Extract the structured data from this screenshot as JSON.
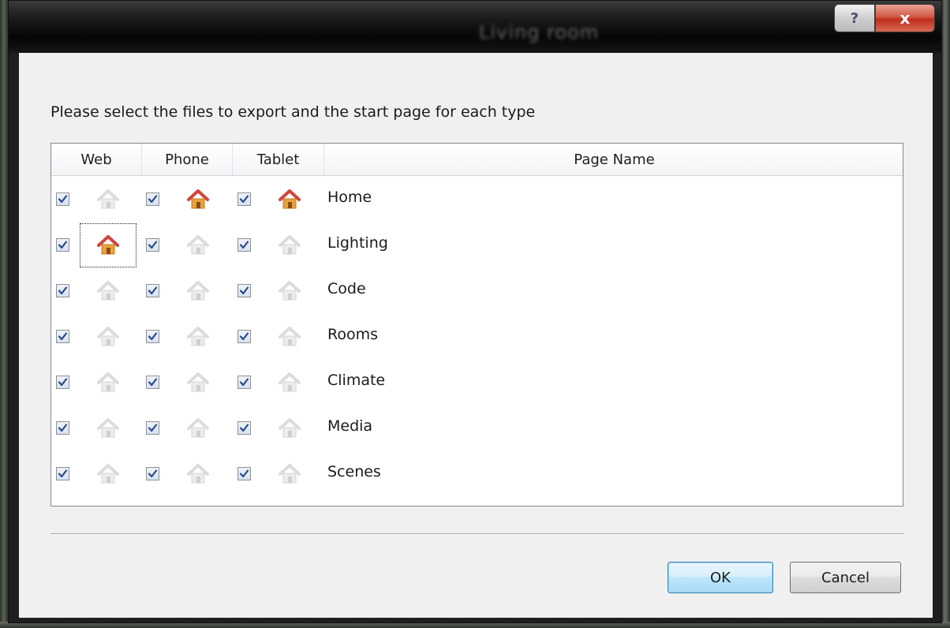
{
  "window": {
    "title": "Living room",
    "help_label": "?",
    "close_label": "x"
  },
  "dialog": {
    "prompt": "Please select the files to export and the start page for each type",
    "columns": [
      "Web",
      "Phone",
      "Tablet",
      "Page Name"
    ],
    "rows": [
      {
        "name": "Home",
        "web": true,
        "web_start": false,
        "phone": true,
        "phone_start": true,
        "tablet": true,
        "tablet_start": true
      },
      {
        "name": "Lighting",
        "web": true,
        "web_start": true,
        "phone": true,
        "phone_start": false,
        "tablet": true,
        "tablet_start": false
      },
      {
        "name": "Code",
        "web": true,
        "web_start": false,
        "phone": true,
        "phone_start": false,
        "tablet": true,
        "tablet_start": false
      },
      {
        "name": "Rooms",
        "web": true,
        "web_start": false,
        "phone": true,
        "phone_start": false,
        "tablet": true,
        "tablet_start": false
      },
      {
        "name": "Climate",
        "web": true,
        "web_start": false,
        "phone": true,
        "phone_start": false,
        "tablet": true,
        "tablet_start": false
      },
      {
        "name": "Media",
        "web": true,
        "web_start": false,
        "phone": true,
        "phone_start": false,
        "tablet": true,
        "tablet_start": false
      },
      {
        "name": "Scenes",
        "web": true,
        "web_start": false,
        "phone": true,
        "phone_start": false,
        "tablet": true,
        "tablet_start": false
      }
    ],
    "focused_cell": "Lighting-web",
    "ok_label": "OK",
    "cancel_label": "Cancel"
  },
  "icons": {
    "checkbox": "checkmark-icon",
    "start_page": "home-icon"
  },
  "colors": {
    "home_active_roof": "#d2443a",
    "home_active_body": "#e9a13b",
    "home_inactive": "#dcdcdc",
    "ok_border": "#3c7fb1"
  }
}
